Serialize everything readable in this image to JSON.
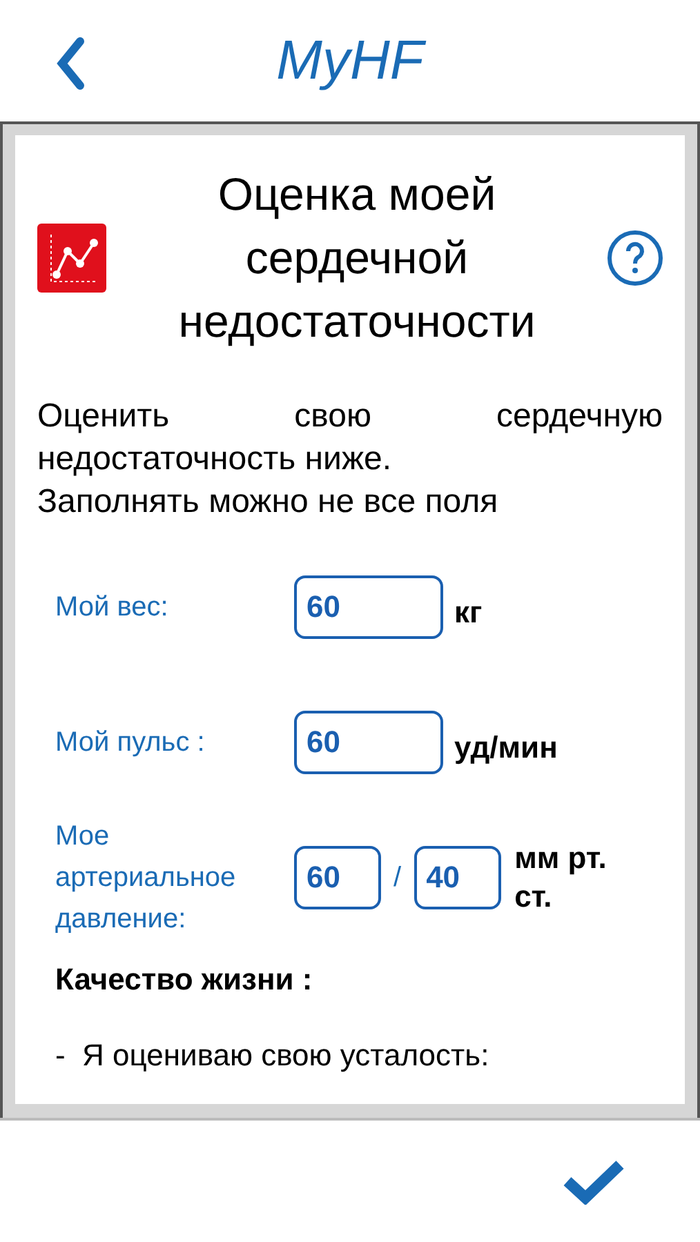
{
  "header": {
    "title": "MyHF"
  },
  "card": {
    "title": "Оценка моей сердечной недостаточности",
    "intro": "Оценить свою сердечную недостаточность ниже.",
    "note": "Заполнять можно не все поля",
    "fields": [
      {
        "label": "Мой вес:",
        "values": [
          "60"
        ],
        "unit": "кг"
      },
      {
        "label": "Мой пульс :",
        "values": [
          "60"
        ],
        "unit": "уд/мин"
      },
      {
        "label": "Мое артериальное давление:",
        "values": [
          "60",
          "40"
        ],
        "separator": "/",
        "unit": "мм рт. ст."
      }
    ],
    "section": "Качество жизни :",
    "cut_line": "-  Я оцениваю свою усталость:"
  }
}
